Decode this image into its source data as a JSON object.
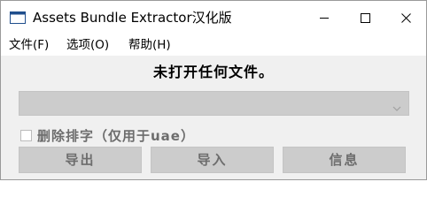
{
  "window": {
    "title": "Assets Bundle Extractor汉化版"
  },
  "menu": {
    "items": [
      "文件(F)",
      "选项(O)",
      "帮助(H)"
    ]
  },
  "main": {
    "status_text": "未打开任何文件。",
    "dropdown": {
      "selected": "",
      "enabled": false
    },
    "checkbox": {
      "label": "删除排字（仅用于uae）",
      "checked": false,
      "enabled": false
    },
    "buttons": {
      "export_label": "导出",
      "import_label": "导入",
      "info_label": "信息"
    }
  },
  "colors": {
    "titlebar": "#ffffff",
    "window_bg": "#f0f0f0",
    "disabled_fill": "#cccccc",
    "disabled_text": "#6d6d6d"
  },
  "icons": [
    "window-app-icon",
    "minimize-icon",
    "maximize-icon",
    "close-icon",
    "chevron-down-icon"
  ]
}
